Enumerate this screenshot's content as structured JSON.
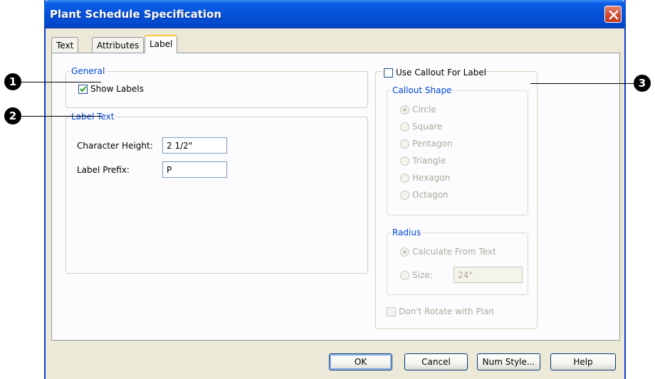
{
  "window": {
    "title": "Plant Schedule Specification"
  },
  "tabs": [
    {
      "label": "Text",
      "active": false
    },
    {
      "label": "Attributes",
      "active": false
    },
    {
      "label": "Label",
      "active": true
    }
  ],
  "general": {
    "legend": "General",
    "show_labels": {
      "label": "Show Labels",
      "checked": true
    }
  },
  "label_text": {
    "legend": "Label Text",
    "character_height": {
      "label": "Character Height:",
      "value": "2 1/2\""
    },
    "label_prefix": {
      "label": "Label Prefix:",
      "value": "P"
    }
  },
  "callout": {
    "use_callout": {
      "label": "Use Callout For Label",
      "checked": false
    },
    "shape": {
      "legend": "Callout Shape",
      "selected": "Circle",
      "options": [
        "Circle",
        "Square",
        "Pentagon",
        "Triangle",
        "Hexagon",
        "Octagon"
      ]
    },
    "radius": {
      "legend": "Radius",
      "calculate_label": "Calculate From Text",
      "size_label": "Size:",
      "size_value": "24\"",
      "selected": "Calculate From Text"
    },
    "dont_rotate": {
      "label": "Don't Rotate with Plan",
      "checked": false
    },
    "enabled": false
  },
  "buttons": {
    "ok": "OK",
    "cancel": "Cancel",
    "num_style": "Num Style...",
    "help": "Help"
  },
  "annotations": [
    "1",
    "2",
    "3"
  ],
  "colors": {
    "titlebar": "#0551d8",
    "legend_text": "#0046d5",
    "dialog_bg": "#ece9d8",
    "active_tab_accent": "#ffc73c"
  }
}
